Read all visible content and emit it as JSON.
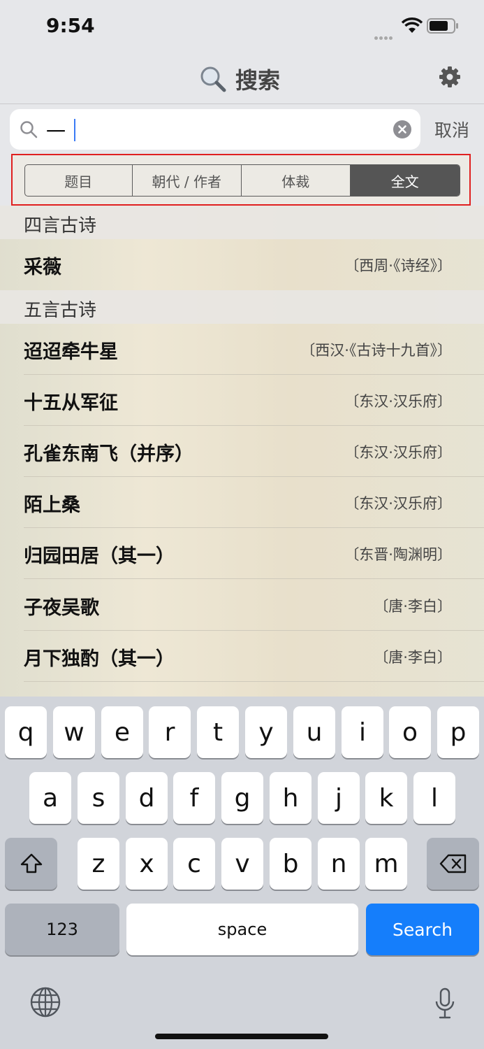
{
  "status_bar": {
    "time": "9:54"
  },
  "header": {
    "title": "搜索"
  },
  "search": {
    "value": "一",
    "cancel_label": "取消"
  },
  "segments": [
    {
      "label": "题目",
      "selected": false
    },
    {
      "label": "朝代 / 作者",
      "selected": false
    },
    {
      "label": "体裁",
      "selected": false
    },
    {
      "label": "全文",
      "selected": true
    }
  ],
  "results": {
    "sections": [
      {
        "header": "四言古诗",
        "items": [
          {
            "title": "采薇",
            "author": "〔西周·《诗经》〕"
          }
        ]
      },
      {
        "header": "五言古诗",
        "items": [
          {
            "title": "迢迢牵牛星",
            "author": "〔西汉·《古诗十九首》〕"
          },
          {
            "title": "十五从军征",
            "author": "〔东汉·汉乐府〕"
          },
          {
            "title": "孔雀东南飞（并序）",
            "author": "〔东汉·汉乐府〕"
          },
          {
            "title": "陌上桑",
            "author": "〔东汉·汉乐府〕"
          },
          {
            "title": "归园田居（其一）",
            "author": "〔东晋·陶渊明〕"
          },
          {
            "title": "子夜吴歌",
            "author": "〔唐·李白〕"
          },
          {
            "title": "月下独酌（其一）",
            "author": "〔唐·李白〕"
          }
        ]
      }
    ]
  },
  "keyboard": {
    "row1": [
      "q",
      "w",
      "e",
      "r",
      "t",
      "y",
      "u",
      "i",
      "o",
      "p"
    ],
    "row2": [
      "a",
      "s",
      "d",
      "f",
      "g",
      "h",
      "j",
      "k",
      "l"
    ],
    "row3": [
      "z",
      "x",
      "c",
      "v",
      "b",
      "n",
      "m"
    ],
    "numbers_label": "123",
    "space_label": "space",
    "search_label": "Search"
  },
  "icons": {
    "search": "magnifier-icon",
    "settings": "gear-icon",
    "clear": "clear-circle-icon",
    "shift": "shift-arrow-icon",
    "delete": "backspace-icon",
    "globe": "globe-icon",
    "mic": "microphone-icon"
  },
  "colors": {
    "accent": "#157efb",
    "selection_outline": "#e02020",
    "segment_active": "#555555"
  }
}
